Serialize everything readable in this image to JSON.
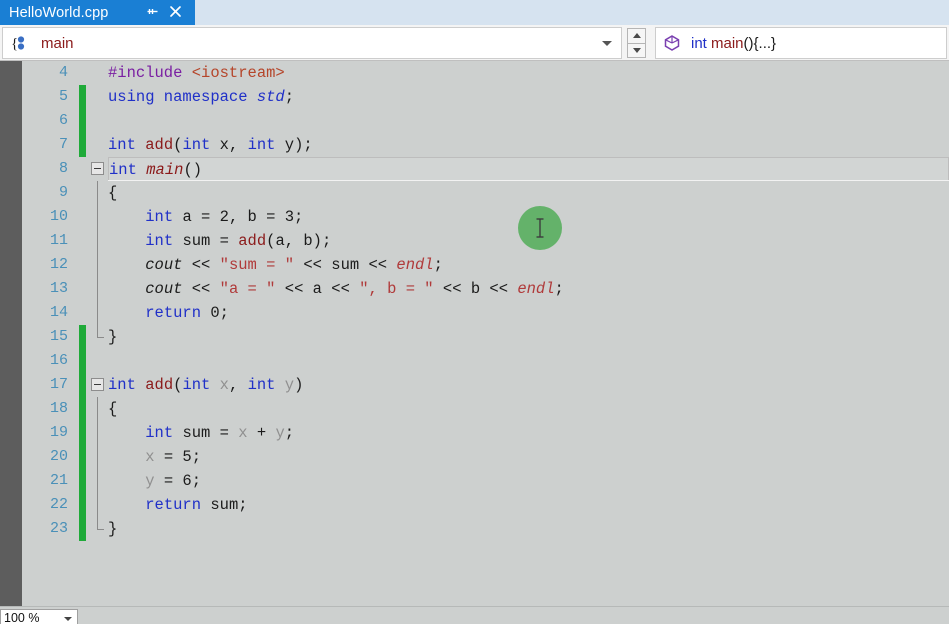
{
  "tab": {
    "title": "HelloWorld.cpp",
    "pin_icon": "pin-icon",
    "close_icon": "close-icon"
  },
  "navbar": {
    "left": {
      "icon": "braces-member-icon",
      "label": "main",
      "dropdown_icon": "chevron-down-icon"
    },
    "spinner": {
      "up_icon": "chevron-up-icon",
      "down_icon": "chevron-down-icon"
    },
    "right": {
      "icon": "cube-member-icon",
      "type": "int",
      "name": "main",
      "punct": "(){...}"
    }
  },
  "editor": {
    "first_line_number": 4,
    "current_line_number": 8,
    "lines": [
      {
        "n": 4,
        "change": "none",
        "fold": "none",
        "guide": "none",
        "tokens": [
          {
            "t": "#include ",
            "c": "pp"
          },
          {
            "t": "<iostream>",
            "c": "inc"
          }
        ]
      },
      {
        "n": 5,
        "change": "green",
        "fold": "none",
        "guide": "none",
        "tokens": [
          {
            "t": "using namespace ",
            "c": "k"
          },
          {
            "t": "std",
            "c": "k it"
          },
          {
            "t": ";",
            "c": "id"
          }
        ]
      },
      {
        "n": 6,
        "change": "green",
        "fold": "none",
        "guide": "none",
        "tokens": []
      },
      {
        "n": 7,
        "change": "green",
        "fold": "none",
        "guide": "none",
        "tokens": [
          {
            "t": "int ",
            "c": "k"
          },
          {
            "t": "add",
            "c": "fn"
          },
          {
            "t": "(",
            "c": "id"
          },
          {
            "t": "int ",
            "c": "k"
          },
          {
            "t": "x",
            "c": "id"
          },
          {
            "t": ", ",
            "c": "id"
          },
          {
            "t": "int ",
            "c": "k"
          },
          {
            "t": "y",
            "c": "id"
          },
          {
            "t": ");",
            "c": "id"
          }
        ]
      },
      {
        "n": 8,
        "change": "none",
        "fold": "collapse",
        "guide": "none",
        "current": true,
        "tokens": [
          {
            "t": "int ",
            "c": "k"
          },
          {
            "t": "main",
            "c": "fn it"
          },
          {
            "t": "()",
            "c": "id"
          }
        ]
      },
      {
        "n": 9,
        "change": "none",
        "fold": "none",
        "guide": "line",
        "tokens": [
          {
            "t": "{",
            "c": "id"
          }
        ]
      },
      {
        "n": 10,
        "change": "none",
        "fold": "none",
        "guide": "line",
        "tokens": [
          {
            "t": "    ",
            "c": "id"
          },
          {
            "t": "int ",
            "c": "k"
          },
          {
            "t": "a = 2, b = 3;",
            "c": "id"
          }
        ]
      },
      {
        "n": 11,
        "change": "none",
        "fold": "none",
        "guide": "line",
        "tokens": [
          {
            "t": "    ",
            "c": "id"
          },
          {
            "t": "int ",
            "c": "k"
          },
          {
            "t": "sum = ",
            "c": "id"
          },
          {
            "t": "add",
            "c": "fn"
          },
          {
            "t": "(a, b);",
            "c": "id"
          }
        ]
      },
      {
        "n": 12,
        "change": "none",
        "fold": "none",
        "guide": "line",
        "tokens": [
          {
            "t": "    ",
            "c": "id"
          },
          {
            "t": "cout",
            "c": "id it"
          },
          {
            "t": " << ",
            "c": "id"
          },
          {
            "t": "\"sum = \"",
            "c": "str"
          },
          {
            "t": " << sum << ",
            "c": "id"
          },
          {
            "t": "endl",
            "c": "str it"
          },
          {
            "t": ";",
            "c": "id"
          }
        ]
      },
      {
        "n": 13,
        "change": "none",
        "fold": "none",
        "guide": "line",
        "tokens": [
          {
            "t": "    ",
            "c": "id"
          },
          {
            "t": "cout",
            "c": "id it"
          },
          {
            "t": " << ",
            "c": "id"
          },
          {
            "t": "\"a = \"",
            "c": "str"
          },
          {
            "t": " << a << ",
            "c": "id"
          },
          {
            "t": "\", b = \"",
            "c": "str"
          },
          {
            "t": " << b << ",
            "c": "id"
          },
          {
            "t": "endl",
            "c": "str it"
          },
          {
            "t": ";",
            "c": "id"
          }
        ]
      },
      {
        "n": 14,
        "change": "none",
        "fold": "none",
        "guide": "line",
        "tokens": [
          {
            "t": "    ",
            "c": "id"
          },
          {
            "t": "return ",
            "c": "k"
          },
          {
            "t": "0;",
            "c": "id"
          }
        ]
      },
      {
        "n": 15,
        "change": "green",
        "fold": "none",
        "guide": "elbow",
        "tokens": [
          {
            "t": "}",
            "c": "id"
          }
        ]
      },
      {
        "n": 16,
        "change": "green",
        "fold": "none",
        "guide": "none",
        "tokens": []
      },
      {
        "n": 17,
        "change": "green",
        "fold": "collapse",
        "guide": "none",
        "tokens": [
          {
            "t": "int ",
            "c": "k"
          },
          {
            "t": "add",
            "c": "fn"
          },
          {
            "t": "(",
            "c": "id"
          },
          {
            "t": "int ",
            "c": "k"
          },
          {
            "t": "x",
            "c": "dim"
          },
          {
            "t": ", ",
            "c": "id"
          },
          {
            "t": "int ",
            "c": "k"
          },
          {
            "t": "y",
            "c": "dim"
          },
          {
            "t": ")",
            "c": "id"
          }
        ]
      },
      {
        "n": 18,
        "change": "green",
        "fold": "none",
        "guide": "line",
        "tokens": [
          {
            "t": "{",
            "c": "id"
          }
        ]
      },
      {
        "n": 19,
        "change": "green",
        "fold": "none",
        "guide": "line",
        "tokens": [
          {
            "t": "    ",
            "c": "id"
          },
          {
            "t": "int ",
            "c": "k"
          },
          {
            "t": "sum = ",
            "c": "id"
          },
          {
            "t": "x",
            "c": "dim"
          },
          {
            "t": " + ",
            "c": "id"
          },
          {
            "t": "y",
            "c": "dim"
          },
          {
            "t": ";",
            "c": "id"
          }
        ]
      },
      {
        "n": 20,
        "change": "green",
        "fold": "none",
        "guide": "line",
        "tokens": [
          {
            "t": "    ",
            "c": "id"
          },
          {
            "t": "x",
            "c": "dim"
          },
          {
            "t": " = 5;",
            "c": "id"
          }
        ]
      },
      {
        "n": 21,
        "change": "green",
        "fold": "none",
        "guide": "line",
        "tokens": [
          {
            "t": "    ",
            "c": "id"
          },
          {
            "t": "y",
            "c": "dim"
          },
          {
            "t": " = 6;",
            "c": "id"
          }
        ]
      },
      {
        "n": 22,
        "change": "green",
        "fold": "none",
        "guide": "line",
        "tokens": [
          {
            "t": "    ",
            "c": "id"
          },
          {
            "t": "return ",
            "c": "k"
          },
          {
            "t": "sum;",
            "c": "id"
          }
        ]
      },
      {
        "n": 23,
        "change": "green",
        "fold": "none",
        "guide": "elbow",
        "tokens": [
          {
            "t": "}",
            "c": "id"
          }
        ]
      }
    ]
  },
  "cursor": {
    "marker_icon": "click-highlight",
    "pointer_icon": "i-beam-cursor"
  },
  "statusbar": {
    "zoom_level": "100 %",
    "zoom_dropdown_icon": "chevron-down-icon"
  },
  "colors": {
    "tab_active": "#1a7fd4",
    "change_bar": "#1faa39",
    "keyword": "#2030c8",
    "string": "#b03a3a",
    "function": "#8b1a1a",
    "preprocessor": "#7a1fa2",
    "editor_bg": "#cdd0cf"
  }
}
